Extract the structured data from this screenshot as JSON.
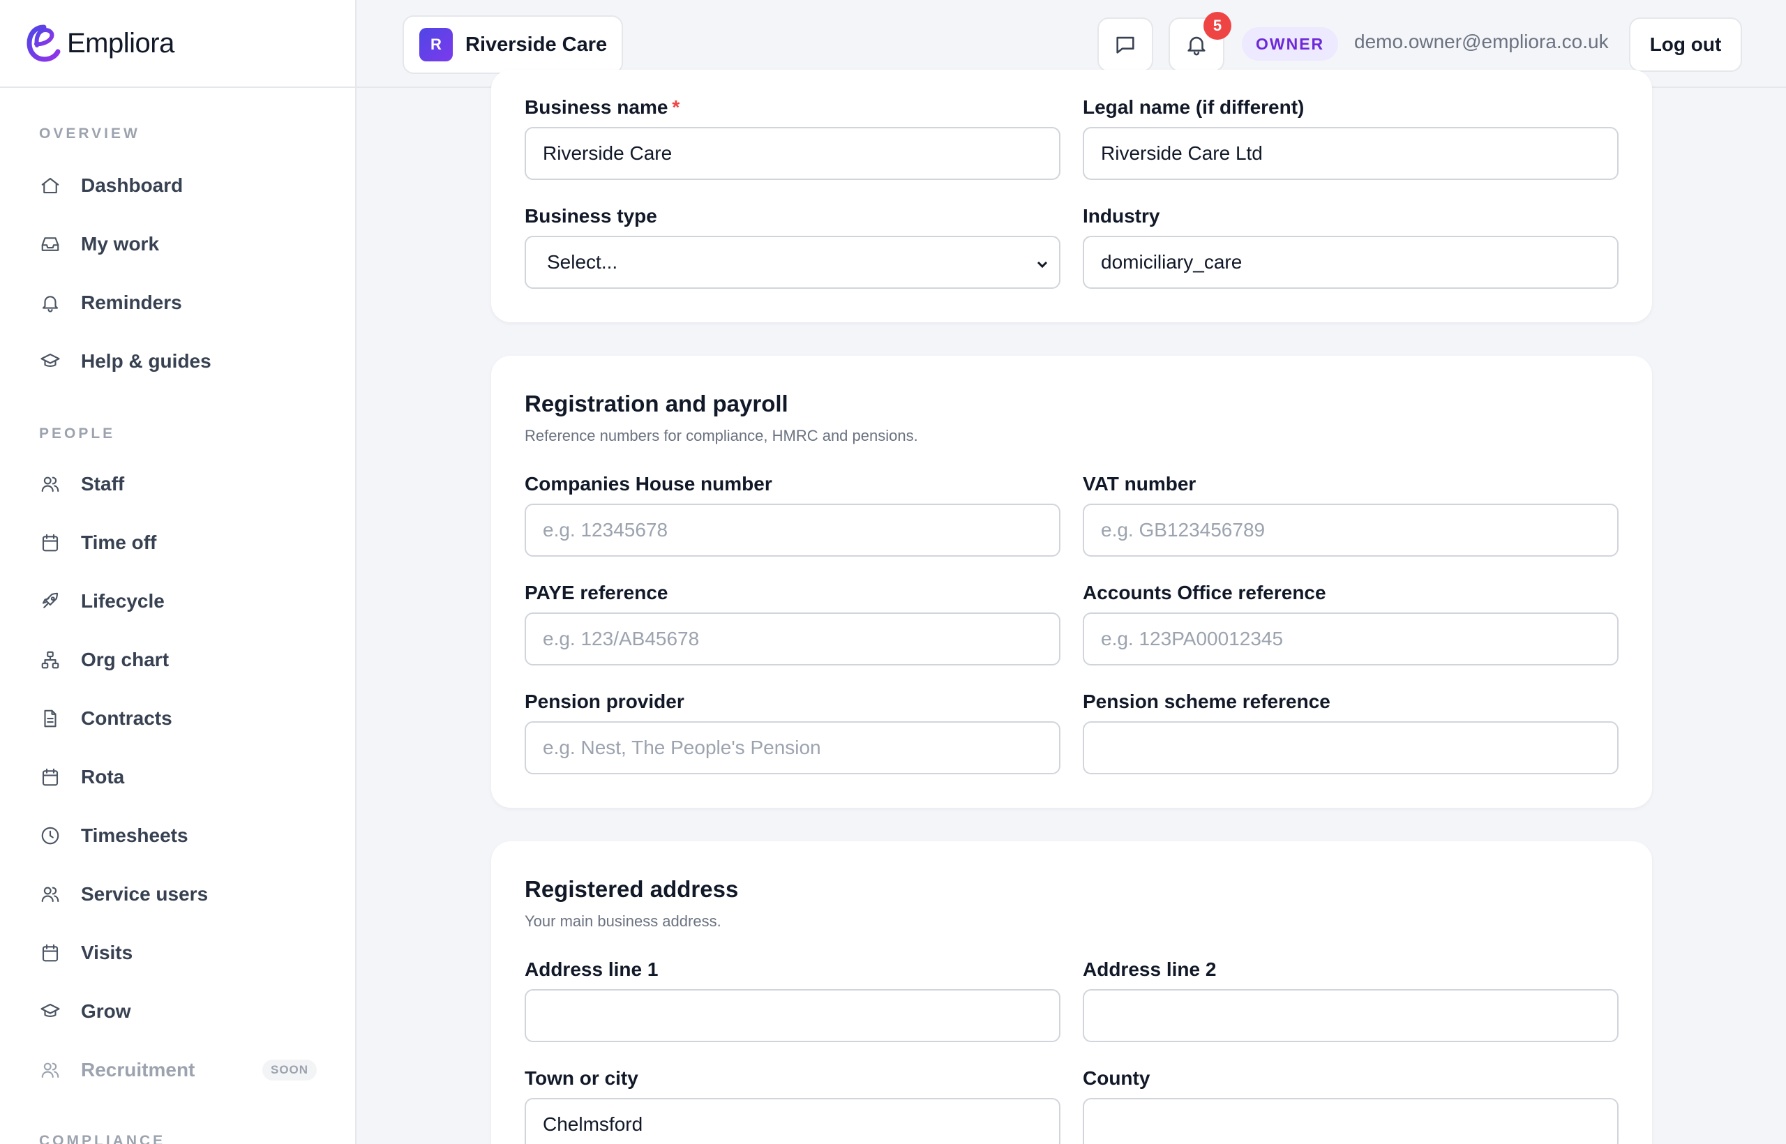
{
  "app": {
    "name": "Empliora"
  },
  "header": {
    "org": {
      "initial": "R",
      "name": "Riverside Care"
    },
    "notifications_count": "5",
    "role": "OWNER",
    "user_email": "demo.owner@empliora.co.uk",
    "logout_label": "Log out"
  },
  "sidebar": {
    "sections": {
      "overview": "OVERVIEW",
      "people": "PEOPLE",
      "compliance": "COMPLIANCE"
    },
    "items": [
      {
        "label": "Dashboard",
        "icon": "home-icon"
      },
      {
        "label": "My work",
        "icon": "inbox-icon"
      },
      {
        "label": "Reminders",
        "icon": "bell-icon"
      },
      {
        "label": "Help & guides",
        "icon": "graduation-cap-icon"
      },
      {
        "label": "Staff",
        "icon": "users-icon"
      },
      {
        "label": "Time off",
        "icon": "calendar-icon"
      },
      {
        "label": "Lifecycle",
        "icon": "rocket-icon"
      },
      {
        "label": "Org chart",
        "icon": "org-chart-icon"
      },
      {
        "label": "Contracts",
        "icon": "document-icon"
      },
      {
        "label": "Rota",
        "icon": "calendar-icon"
      },
      {
        "label": "Timesheets",
        "icon": "clock-icon"
      },
      {
        "label": "Service users",
        "icon": "users-icon"
      },
      {
        "label": "Visits",
        "icon": "calendar-icon"
      },
      {
        "label": "Grow",
        "icon": "graduation-cap-icon"
      },
      {
        "label": "Recruitment",
        "icon": "users-icon",
        "badge": "SOON"
      }
    ]
  },
  "business": {
    "business_name_label": "Business name",
    "business_name_value": "Riverside Care",
    "legal_name_label": "Legal name (if different)",
    "legal_name_value": "Riverside Care Ltd",
    "business_type_label": "Business type",
    "business_type_value": "Select...",
    "industry_label": "Industry",
    "industry_value": "domiciliary_care"
  },
  "registration": {
    "title": "Registration and payroll",
    "subtitle": "Reference numbers for compliance, HMRC and pensions.",
    "companies_house_label": "Companies House number",
    "companies_house_placeholder": "e.g. 12345678",
    "vat_label": "VAT number",
    "vat_placeholder": "e.g. GB123456789",
    "paye_label": "PAYE reference",
    "paye_placeholder": "e.g. 123/AB45678",
    "accounts_office_label": "Accounts Office reference",
    "accounts_office_placeholder": "e.g. 123PA00012345",
    "pension_provider_label": "Pension provider",
    "pension_provider_placeholder": "e.g. Nest, The People's Pension",
    "pension_scheme_label": "Pension scheme reference",
    "pension_scheme_value": ""
  },
  "address": {
    "title": "Registered address",
    "subtitle": "Your main business address.",
    "line1_label": "Address line 1",
    "line1_value": "",
    "line2_label": "Address line 2",
    "line2_value": "",
    "town_label": "Town or city",
    "town_value": "Chelmsford",
    "county_label": "County",
    "county_value": ""
  },
  "colors": {
    "accent": "#6d28d9",
    "badge_red": "#ef4444",
    "page_bg": "#f4f5f9"
  }
}
